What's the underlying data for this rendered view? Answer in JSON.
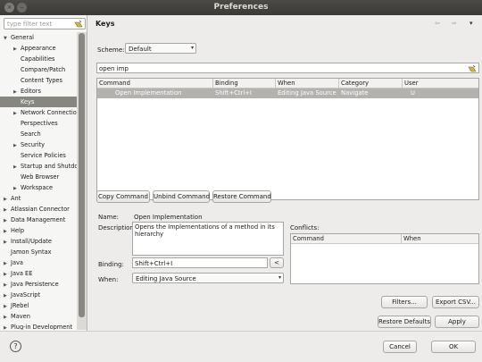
{
  "window": {
    "title": "Preferences",
    "close_glyph": "×",
    "min_glyph": "–"
  },
  "left": {
    "filter_placeholder": "type filter text",
    "tree": [
      {
        "label": "General",
        "indent": 0,
        "arrow": "▼"
      },
      {
        "label": "Appearance",
        "indent": 1,
        "arrow": "▶"
      },
      {
        "label": "Capabilities",
        "indent": 1,
        "arrow": ""
      },
      {
        "label": "Compare/Patch",
        "indent": 1,
        "arrow": ""
      },
      {
        "label": "Content Types",
        "indent": 1,
        "arrow": ""
      },
      {
        "label": "Editors",
        "indent": 1,
        "arrow": "▶"
      },
      {
        "label": "Keys",
        "indent": 1,
        "arrow": "",
        "selected": true
      },
      {
        "label": "Network Connectio",
        "indent": 1,
        "arrow": "▶"
      },
      {
        "label": "Perspectives",
        "indent": 1,
        "arrow": ""
      },
      {
        "label": "Search",
        "indent": 1,
        "arrow": ""
      },
      {
        "label": "Security",
        "indent": 1,
        "arrow": "▶"
      },
      {
        "label": "Service Policies",
        "indent": 1,
        "arrow": ""
      },
      {
        "label": "Startup and Shutdo",
        "indent": 1,
        "arrow": "▶"
      },
      {
        "label": "Web Browser",
        "indent": 1,
        "arrow": ""
      },
      {
        "label": "Workspace",
        "indent": 1,
        "arrow": "▶"
      },
      {
        "label": "Ant",
        "indent": 0,
        "arrow": "▶"
      },
      {
        "label": "Atlassian Connector",
        "indent": 0,
        "arrow": "▶"
      },
      {
        "label": "Data Management",
        "indent": 0,
        "arrow": "▶"
      },
      {
        "label": "Help",
        "indent": 0,
        "arrow": "▶"
      },
      {
        "label": "Install/Update",
        "indent": 0,
        "arrow": "▶"
      },
      {
        "label": "Jamon Syntax",
        "indent": 0,
        "arrow": ""
      },
      {
        "label": "Java",
        "indent": 0,
        "arrow": "▶"
      },
      {
        "label": "Java EE",
        "indent": 0,
        "arrow": "▶"
      },
      {
        "label": "Java Persistence",
        "indent": 0,
        "arrow": "▶"
      },
      {
        "label": "JavaScript",
        "indent": 0,
        "arrow": "▶"
      },
      {
        "label": "JRebel",
        "indent": 0,
        "arrow": "▶"
      },
      {
        "label": "Maven",
        "indent": 0,
        "arrow": "▶"
      },
      {
        "label": "Plug-in Development",
        "indent": 0,
        "arrow": "▶"
      }
    ]
  },
  "page": {
    "title": "Keys",
    "nav_back": "⇦",
    "nav_fwd": "⇨",
    "nav_menu": "▾",
    "scheme_label": "Scheme:",
    "scheme_value": "Default",
    "search_value": "open imp",
    "table": {
      "columns": [
        "Command",
        "Binding",
        "When",
        "Category",
        "User"
      ],
      "rows": [
        {
          "command": "Open Implementation",
          "binding": "Shift+Ctrl+I",
          "when": "Editing Java Source",
          "category": "Navigate",
          "user": "U"
        }
      ]
    },
    "buttons": {
      "copy": "Copy Command",
      "unbind": "Unbind Command",
      "restore": "Restore Command"
    },
    "name_label": "Name:",
    "name_value": "Open Implementation",
    "description_label": "Description:",
    "description_value": "Opens the Implementations of a method in its hierarchy",
    "binding_label": "Binding:",
    "binding_value": "Shift+Ctrl+I",
    "binding_btn": "<",
    "when_label": "When:",
    "when_value": "Editing Java Source",
    "conflicts_label": "Conflicts:",
    "conflicts_columns": [
      "Command",
      "When"
    ],
    "filters_btn": "Filters...",
    "export_btn": "Export CSV...",
    "restore_defaults_btn": "Restore Defaults",
    "apply_btn": "Apply"
  },
  "bottom": {
    "help_glyph": "?",
    "cancel": "Cancel",
    "ok": "OK"
  }
}
